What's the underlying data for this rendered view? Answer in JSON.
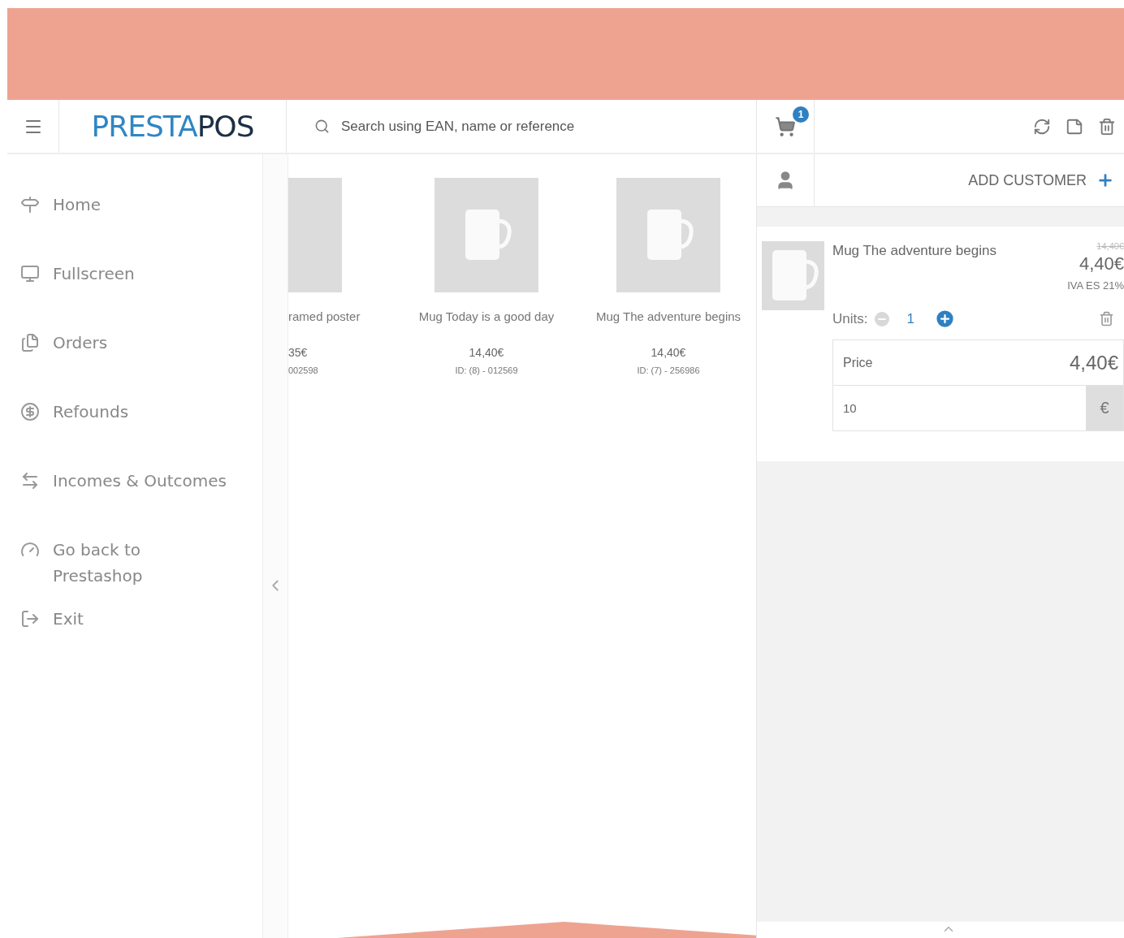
{
  "header": {
    "logo": {
      "part_1": "PRESTA",
      "part_2": "POS"
    },
    "search": {
      "placeholder": "Search using EAN, name or reference"
    },
    "cart_count": "1"
  },
  "sidebar": {
    "items": [
      {
        "label": "Home"
      },
      {
        "label": "Fullscreen"
      },
      {
        "label": "Orders"
      },
      {
        "label": "Refounds"
      },
      {
        "label": "Incomes & Outcomes"
      },
      {
        "label": "Go back to Prestashop"
      },
      {
        "label": "Exit"
      }
    ]
  },
  "products": [
    {
      "kind": "partial",
      "name": "ramed poster",
      "price": "35€",
      "ref": "002598"
    },
    {
      "kind": "full",
      "name": "Mug Today is a good day",
      "price": "14,40€",
      "ref": "ID: (8) - 012569"
    },
    {
      "kind": "full",
      "name": "Mug The adventure begins",
      "price": "14,40€",
      "ref": "ID: (7) - 256986"
    }
  ],
  "cart": {
    "add_customer": "ADD CUSTOMER",
    "items": [
      {
        "name": "Mug The adventure begins",
        "old_price": "14,40€",
        "price": "4,40€",
        "tax": "IVA ES 21%",
        "units_label": "Units:",
        "units": "1",
        "minus_disabled": true,
        "price_label": "Price",
        "price_value": "4,40€",
        "discount": "10",
        "discount_unit": "€"
      }
    ]
  }
}
